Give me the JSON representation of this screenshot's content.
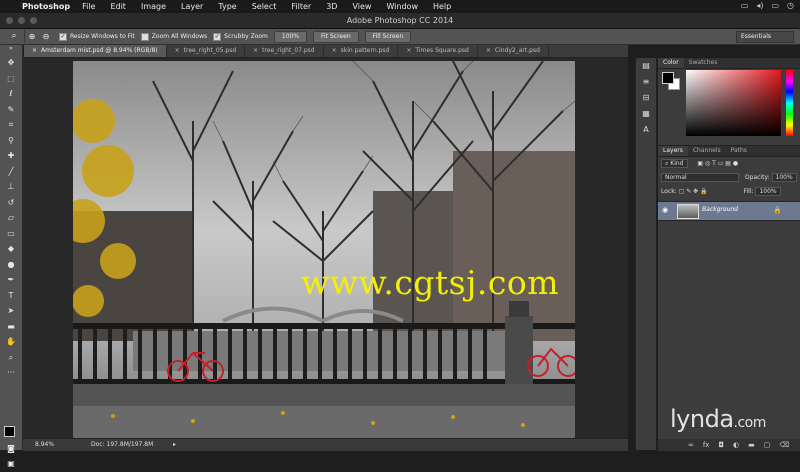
{
  "menubar": {
    "app_name": "Photoshop",
    "items": [
      "File",
      "Edit",
      "Image",
      "Layer",
      "Type",
      "Select",
      "Filter",
      "3D",
      "View",
      "Window",
      "Help"
    ],
    "status_icons": [
      "cast-icon",
      "volume-icon",
      "battery-icon",
      "clock-icon"
    ]
  },
  "window": {
    "title": "Adobe Photoshop CC 2014"
  },
  "options_bar": {
    "tool_icon": "zoom-tool-icon",
    "resize_windows": "Resize Windows to Fit",
    "zoom_all_windows": "Zoom All Windows",
    "scrubby_zoom": "Scrubby Zoom",
    "btn_100": "100%",
    "btn_fit_screen": "Fit Screen",
    "btn_fill_screen": "Fill Screen",
    "workspace": "Essentials",
    "resize_checked": true,
    "zoom_all_checked": false,
    "scrubby_checked": true
  },
  "tabs": [
    {
      "label": "Amsterdam mist.psd @ 8.94% (RGB/8)",
      "active": true
    },
    {
      "label": "tree_right_05.psd",
      "active": false
    },
    {
      "label": "tree_right_07.psd",
      "active": false
    },
    {
      "label": "skin pattern.psd",
      "active": false
    },
    {
      "label": "Times Square.psd",
      "active": false
    },
    {
      "label": "Cindy2_art.psd",
      "active": false
    }
  ],
  "canvas": {
    "watermark": "www.cgtsj.com",
    "scene_colors": {
      "fog": "#b8b8b8",
      "foliage": "#c8a21a",
      "bike": "#c81e28"
    }
  },
  "status_bar": {
    "zoom": "8.94%",
    "doc": "Doc: 197.8M/197.8M"
  },
  "panels": {
    "color_tabs": [
      "Color",
      "Swatches"
    ],
    "layers_tabs": [
      "Layers",
      "Channels",
      "Paths"
    ],
    "kind": "Kind",
    "blend_mode": "Normal",
    "opacity_label": "Opacity:",
    "opacity_value": "100%",
    "lock_label": "Lock:",
    "fill_label": "Fill:",
    "fill_value": "100%",
    "layer_name": "Background",
    "accent_color": "#e3191f",
    "footer_icons": [
      "link-icon",
      "fx-icon",
      "mask-icon",
      "adjustment-icon",
      "folder-icon",
      "new-layer-icon",
      "trash-icon"
    ]
  },
  "branding": {
    "logo": "lynda.com"
  }
}
